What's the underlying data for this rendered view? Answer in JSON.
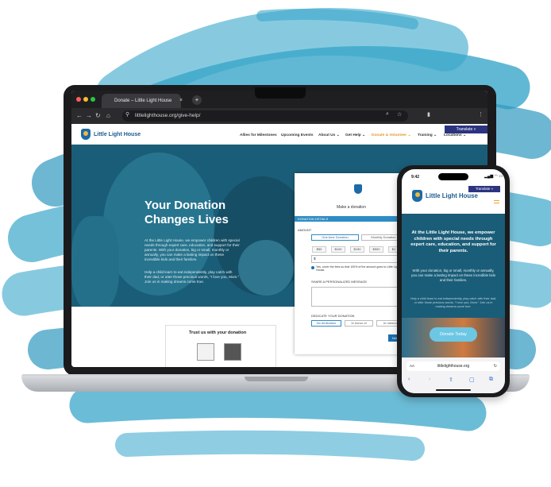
{
  "browser": {
    "tab_title": "Donate – Little Light House",
    "tab_close": "×",
    "new_tab": "+",
    "url": "littlelighthouse.org/give-help/"
  },
  "site": {
    "logo": "Little Light House",
    "translate": "Translate »",
    "nav": [
      "Allies for Milestones",
      "Upcoming Events",
      "About Us ⌄",
      "Get Help ⌄",
      "Donate & Volunteer ⌄",
      "Training ⌄",
      "Locations ⌄"
    ],
    "hero_title": "Your Donation Changes Lives",
    "hero_p1": "At the Little Light House, we empower children with special needs through expert care, education, and support for their parents. With your donation, big or small, monthly or annually, you can make a lasting impact on these incredible kids and their families.",
    "hero_p2": "Help a child learn to eat independently, play catch with their dad, or utter those precious words, \"I love you, Mom.\" Join us in making dreams come true."
  },
  "donation_form": {
    "heading": "Make a donation",
    "details_bar": "DONATION DETAILS",
    "amount_label": "AMOUNT",
    "frequency": [
      "One-time Donation",
      "Monthly Donation"
    ],
    "amounts": [
      "$50",
      "$100",
      "$150",
      "$500",
      "$1"
    ],
    "currency": "$",
    "fee_text": "Yes, cover the fees so that 100% of the amount goes to Little Light House.",
    "message_label": "SHARE A PERSONALIZED MESSAGE",
    "dedicate_label": "DEDICATE YOUR DONATION",
    "dedicate_options": [
      "No dedication",
      "In honor of",
      "In memory"
    ],
    "next": "Next"
  },
  "trust": {
    "title": "Trust us with your donation"
  },
  "phone": {
    "time": "9:42",
    "status": "▂▄▆ ◠ ▭",
    "translate": "Translate »",
    "logo": "Little Light House",
    "title": "At the Little Light House, we empower children with special needs through expert care, education, and support for their parents.",
    "body1": "With your donation, big or small, monthly or annually, you can make a lasting impact on these incredible kids and their families.",
    "body2": "Help a child learn to eat independently, play catch with their dad, or utter those precious words, \"I love you, Mom.\" Join us in making dreams come true.",
    "button": "Donate Today",
    "url": "littlelighthouse.org",
    "aa": "AA",
    "reload": "↻",
    "nav": [
      "‹",
      "›",
      "⇧",
      "▢",
      "⧉"
    ]
  },
  "colors": {
    "brush": "#3aa6c9",
    "hero": "#1a5d78",
    "brand": "#1c5a8e",
    "accent": "#2e8cc4",
    "translate_bg": "#2c3480"
  }
}
